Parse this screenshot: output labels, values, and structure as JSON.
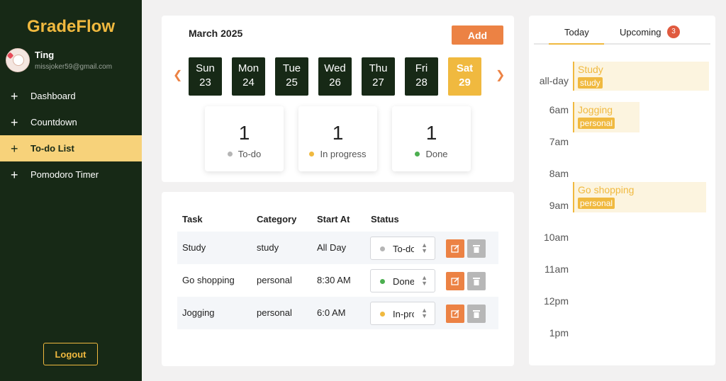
{
  "app": {
    "name": "GradeFlow"
  },
  "user": {
    "name": "Ting",
    "email": "missjoker59@gmail.com"
  },
  "sidebar": {
    "items": [
      {
        "label": "Dashboard"
      },
      {
        "label": "Countdown"
      },
      {
        "label": "To-do List",
        "active": true
      },
      {
        "label": "Pomodoro Timer"
      }
    ],
    "logout_label": "Logout"
  },
  "calendar": {
    "month": "March 2025",
    "add_label": "Add",
    "days": [
      {
        "name": "Sun",
        "num": "23"
      },
      {
        "name": "Mon",
        "num": "24"
      },
      {
        "name": "Tue",
        "num": "25"
      },
      {
        "name": "Wed",
        "num": "26"
      },
      {
        "name": "Thu",
        "num": "27"
      },
      {
        "name": "Fri",
        "num": "28"
      },
      {
        "name": "Sat",
        "num": "29",
        "selected": true
      }
    ]
  },
  "stats": [
    {
      "count": "1",
      "label": "To-do",
      "color": "#b5b5b5"
    },
    {
      "count": "1",
      "label": "In progress",
      "color": "#f0b93f"
    },
    {
      "count": "1",
      "label": "Done",
      "color": "#4caf50"
    }
  ],
  "table": {
    "headers": [
      "Task",
      "Category",
      "Start At",
      "Status"
    ],
    "rows": [
      {
        "task": "Study",
        "category": "study",
        "start": "All Day",
        "status": "To-do",
        "status_color": "#b5b5b5"
      },
      {
        "task": "Go shopping",
        "category": "personal",
        "start": "8:30 AM",
        "status": "Done",
        "status_color": "#4caf50"
      },
      {
        "task": "Jogging",
        "category": "personal",
        "start": "6:0 AM",
        "status": "In-progress",
        "status_color": "#f0b93f"
      }
    ]
  },
  "schedule": {
    "tabs": {
      "today": "Today",
      "upcoming": "Upcoming",
      "upcoming_count": "3"
    },
    "times": [
      "all-day",
      "6am",
      "7am",
      "8am",
      "9am",
      "10am",
      "11am",
      "12pm",
      "1pm"
    ],
    "events": [
      {
        "title": "Study",
        "tag": "study"
      },
      {
        "title": "Jogging",
        "tag": "personal"
      },
      {
        "title": "Go shopping",
        "tag": "personal"
      }
    ]
  },
  "colors": {
    "sidebar": "#172916",
    "accent": "#f0b93f",
    "orange": "#ec8244"
  }
}
